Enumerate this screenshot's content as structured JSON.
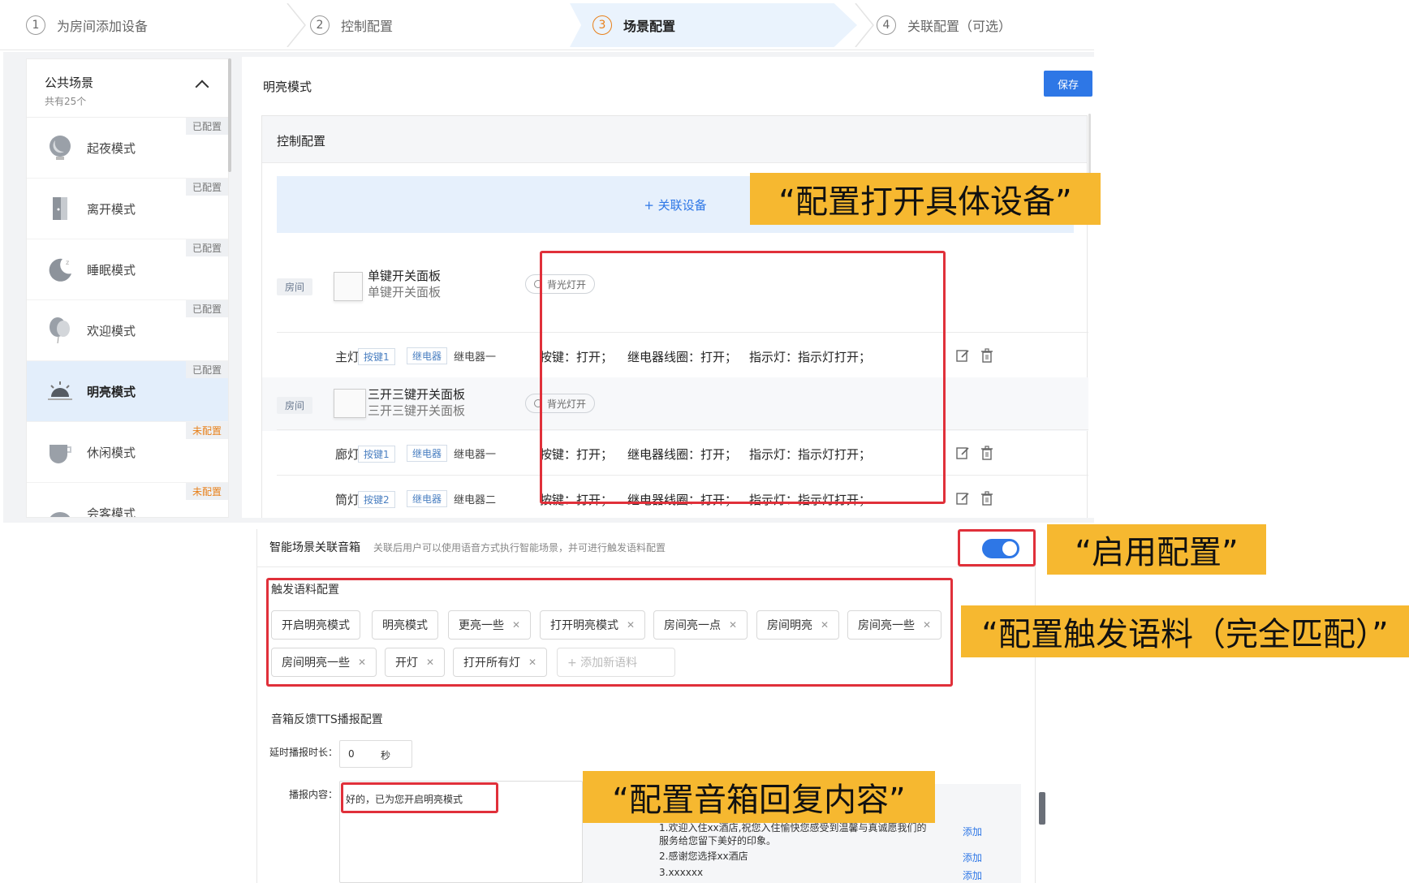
{
  "steps": [
    {
      "num": "1",
      "label": "为房间添加设备"
    },
    {
      "num": "2",
      "label": "控制配置"
    },
    {
      "num": "3",
      "label": "场景配置"
    },
    {
      "num": "4",
      "label": "关联配置（可选）"
    }
  ],
  "left_panel": {
    "title": "公共场景",
    "subtitle": "共有25个",
    "scenes": [
      {
        "name": "起夜模式",
        "status": "已配置"
      },
      {
        "name": "离开模式",
        "status": "已配置"
      },
      {
        "name": "睡眠模式",
        "status": "已配置"
      },
      {
        "name": "欢迎模式",
        "status": "已配置"
      },
      {
        "name": "明亮模式",
        "status": "已配置"
      },
      {
        "name": "休闲模式",
        "status": "未配置"
      },
      {
        "name": "会客模式",
        "status": "未配置"
      }
    ]
  },
  "right_panel": {
    "title": "明亮模式",
    "save_label": "保存",
    "control_title": "控制配置",
    "assoc_label": "+ 关联设备",
    "room_tag": "房间",
    "devices": [
      {
        "name": "单键开关面板",
        "sub": "单键开关面板",
        "pill": "背光灯开",
        "keys": [
          {
            "label": "主灯",
            "key": "按键1",
            "relay": "继电器",
            "relay_name": "继电器一",
            "a1": "按键：打开；",
            "a2": "继电器线圈：打开；",
            "a3": "指示灯：指示灯打开；"
          }
        ]
      },
      {
        "name": "三开三键开关面板",
        "sub": "三开三键开关面板",
        "pill": "背光灯开",
        "keys": [
          {
            "label": "廊灯",
            "key": "按键1",
            "relay": "继电器",
            "relay_name": "继电器一",
            "a1": "按键：打开；",
            "a2": "继电器线圈：打开；",
            "a3": "指示灯：指示灯打开；"
          },
          {
            "label": "筒灯",
            "key": "按键2",
            "relay": "继电器",
            "relay_name": "继电器二",
            "a1": "按键：打开；",
            "a2": "继电器线圈：打开；",
            "a3": "指示灯：指示灯打开；"
          }
        ]
      }
    ]
  },
  "speaker": {
    "title": "智能场景关联音箱",
    "desc": "关联后用户可以使用语音方式执行智能场景，并可进行触发语料配置",
    "enabled": true,
    "trigger_title": "触发语料配置",
    "phrases": [
      "开启明亮模式",
      "明亮模式",
      "更亮一些",
      "打开明亮模式",
      "房间亮一点",
      "房间明亮",
      "房间亮一些",
      "房间明亮一些",
      "开灯",
      "打开所有灯"
    ],
    "add_phrase": "+ 添加新语料",
    "tts_title": "音箱反馈TTS播报配置",
    "delay_label": "延时播报时长：",
    "delay_value": "0",
    "delay_unit": "秒",
    "content_label": "播报内容：",
    "content_value": "好的，已为您开启明亮模式",
    "suggestions": [
      "1.欢迎入住xx酒店,祝您入住愉快您感受到温馨与真诚愿我们的服务给您留下美好的印象。",
      "2.感谢您选择xx酒店",
      "3.xxxxxx"
    ],
    "suggest_add": "添加"
  },
  "callouts": {
    "c1": "“配置打开具体设备”",
    "c2": "“启用配置”",
    "c3": "“配置触发语料（完全匹配）”",
    "c4": "“配置音箱回复内容”"
  },
  "colors": {
    "primary": "#2e77e6",
    "callout": "#f6b830",
    "highlight": "#e0303a",
    "warn": "#e8801a"
  }
}
